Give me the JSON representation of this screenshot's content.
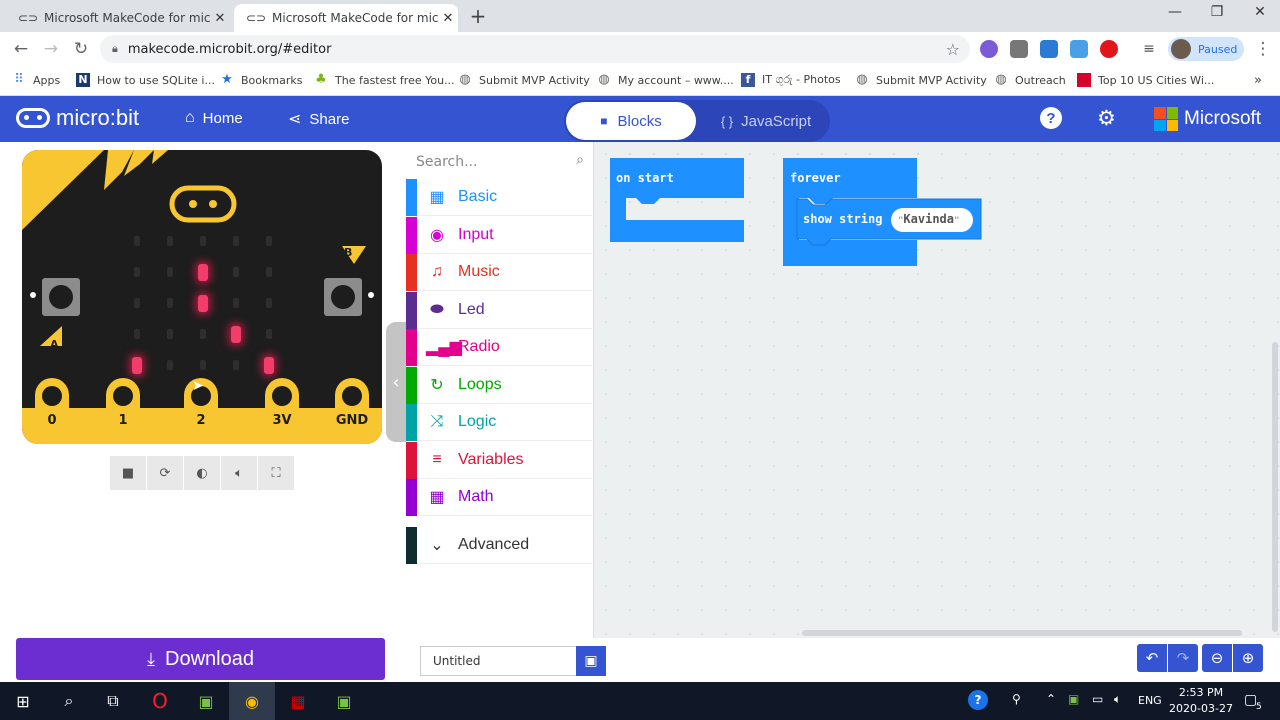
{
  "browser": {
    "tabs": [
      {
        "title": "Microsoft MakeCode for micro:bit",
        "active": false
      },
      {
        "title": "Microsoft MakeCode for micro:bit",
        "active": true
      }
    ],
    "url": "makecode.microbit.org/#editor",
    "profile_status": "Paused",
    "bookmarks": [
      {
        "label": "Apps",
        "icon": "apps-icon"
      },
      {
        "label": "How to use SQLite i...",
        "icon": "n-icon"
      },
      {
        "label": "Bookmarks",
        "icon": "star-icon"
      },
      {
        "label": "The fastest free You...",
        "icon": "leaf-icon"
      },
      {
        "label": "Submit MVP Activity",
        "icon": "globe-icon"
      },
      {
        "label": "My account – www....",
        "icon": "globe-icon"
      },
      {
        "label": "IT ගුරු - Photos",
        "icon": "facebook-icon"
      },
      {
        "label": "Submit MVP Activity",
        "icon": "globe-icon"
      },
      {
        "label": "Outreach",
        "icon": "globe-icon"
      },
      {
        "label": "Top 10 US Cities Wi...",
        "icon": "red-square-icon"
      }
    ]
  },
  "header": {
    "logo": "micro:bit",
    "home": "Home",
    "share": "Share",
    "blocks_tab": "Blocks",
    "js_tab": "JavaScript",
    "brand": "Microsoft"
  },
  "simulator": {
    "button_a": "A",
    "button_b": "B",
    "pins": [
      "0",
      "1",
      "2",
      "3V",
      "GND"
    ],
    "leds_on": [
      [
        1,
        2
      ],
      [
        2,
        2
      ],
      [
        3,
        3
      ],
      [
        4,
        1
      ],
      [
        4,
        4
      ]
    ]
  },
  "toolbox": {
    "search_placeholder": "Search...",
    "categories": [
      {
        "label": "Basic",
        "color": "#1e90ff",
        "icon": "grid-icon"
      },
      {
        "label": "Input",
        "color": "#d400d4",
        "icon": "target-icon"
      },
      {
        "label": "Music",
        "color": "#e63022",
        "icon": "headphones-icon"
      },
      {
        "label": "Led",
        "color": "#5c2d91",
        "icon": "toggle-icon"
      },
      {
        "label": "Radio",
        "color": "#e3008c",
        "icon": "signal-icon"
      },
      {
        "label": "Loops",
        "color": "#00aa00",
        "icon": "refresh-icon"
      },
      {
        "label": "Logic",
        "color": "#00a4a6",
        "icon": "shuffle-icon"
      },
      {
        "label": "Variables",
        "color": "#dc143c",
        "icon": "lines-icon"
      },
      {
        "label": "Math",
        "color": "#9400d3",
        "icon": "calculator-icon"
      },
      {
        "label": "Advanced",
        "color": "#0f2c2e",
        "icon": "chevron-down-icon"
      }
    ]
  },
  "workspace": {
    "on_start": "on start",
    "forever": "forever",
    "show_string": "show string",
    "string_value": "Kavinda"
  },
  "bottom": {
    "download": "Download",
    "project_name": "Untitled"
  },
  "taskbar": {
    "language": "ENG",
    "time": "2:53 PM",
    "date": "2020-03-27",
    "notifications": "5"
  }
}
